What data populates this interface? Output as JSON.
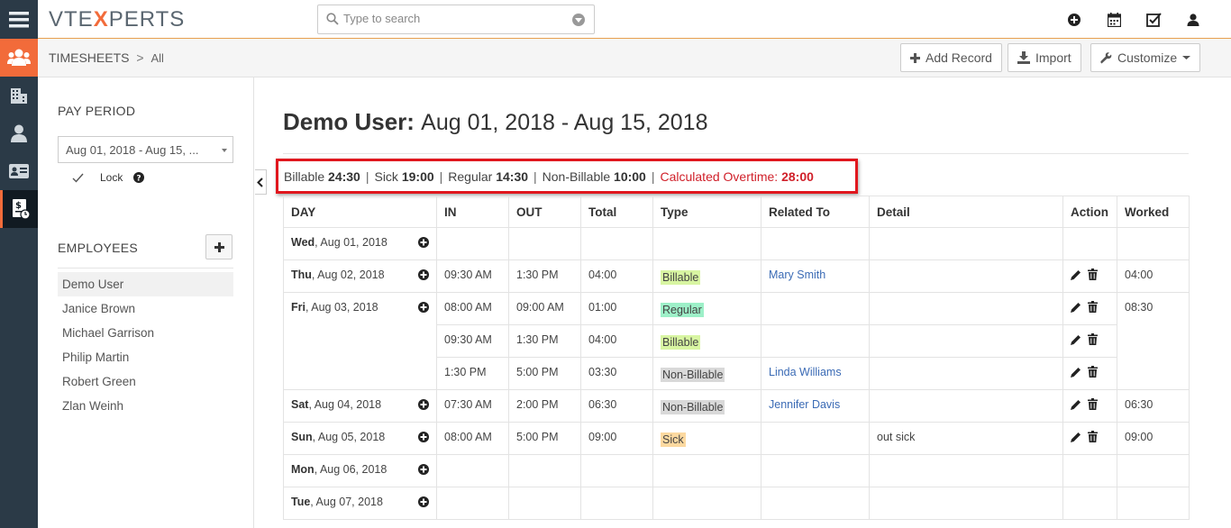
{
  "app": {
    "logo_pre": "VTE",
    "logo_x": "X",
    "logo_post": "PERTS"
  },
  "search": {
    "placeholder": "Type to search"
  },
  "breadcrumb": {
    "module": "TIMESHEETS",
    "separator": ">",
    "view": "All"
  },
  "toolbar": {
    "add_record": "Add Record",
    "import": "Import",
    "customize": "Customize"
  },
  "left": {
    "pay_period_title": "PAY PERIOD",
    "pay_period_value": "Aug 01, 2018 - Aug 15, ...",
    "lock_label": "Lock",
    "employees_title": "EMPLOYEES",
    "employees": [
      "Demo User",
      "Janice Brown",
      "Michael Garrison",
      "Philip Martin",
      "Robert Green",
      "Zlan Weinh"
    ]
  },
  "main": {
    "user": "Demo User:",
    "range": "Aug 01, 2018 - Aug 15, 2018",
    "summary": {
      "billable_label": "Billable",
      "billable": "24:30",
      "sick_label": "Sick",
      "sick": "19:00",
      "regular_label": "Regular",
      "regular": "14:30",
      "nonbillable_label": "Non-Billable",
      "nonbillable": "10:00",
      "overtime_label": "Calculated Overtime:",
      "overtime": "28:00",
      "pipe": "|"
    },
    "columns": [
      "DAY",
      "IN",
      "OUT",
      "Total",
      "Type",
      "Related To",
      "Detail",
      "Action",
      "Worked"
    ],
    "rows": {
      "r1": {
        "dow": "Wed",
        "date": ", Aug 01, 2018"
      },
      "r2": {
        "dow": "Thu",
        "date": ", Aug 02, 2018",
        "in": "09:30 AM",
        "out": "1:30 PM",
        "total": "04:00",
        "type": "Billable",
        "related": "Mary Smith",
        "worked": "04:00"
      },
      "r3": {
        "dow": "Fri",
        "date": ", Aug 03, 2018",
        "worked": "08:30",
        "e1": {
          "in": "08:00 AM",
          "out": "09:00 AM",
          "total": "01:00",
          "type": "Regular"
        },
        "e2": {
          "in": "09:30 AM",
          "out": "1:30 PM",
          "total": "04:00",
          "type": "Billable"
        },
        "e3": {
          "in": "1:30 PM",
          "out": "5:00 PM",
          "total": "03:30",
          "type": "Non-Billable",
          "related": "Linda Williams"
        }
      },
      "r4": {
        "dow": "Sat",
        "date": ", Aug 04, 2018",
        "in": "07:30 AM",
        "out": "2:00 PM",
        "total": "06:30",
        "type": "Non-Billable",
        "related": "Jennifer Davis",
        "worked": "06:30"
      },
      "r5": {
        "dow": "Sun",
        "date": ", Aug 05, 2018",
        "in": "08:00 AM",
        "out": "5:00 PM",
        "total": "09:00",
        "type": "Sick",
        "detail": "out sick",
        "worked": "09:00"
      },
      "r6": {
        "dow": "Mon",
        "date": ", Aug 06, 2018"
      },
      "r7": {
        "dow": "Tue",
        "date": ", Aug 07, 2018"
      }
    }
  },
  "colors": {
    "accent": "#f26b3a",
    "rail": "#2b3a47",
    "highlight_border": "#e0171e",
    "overtime": "#d0202a",
    "link": "#3b6bb5"
  }
}
